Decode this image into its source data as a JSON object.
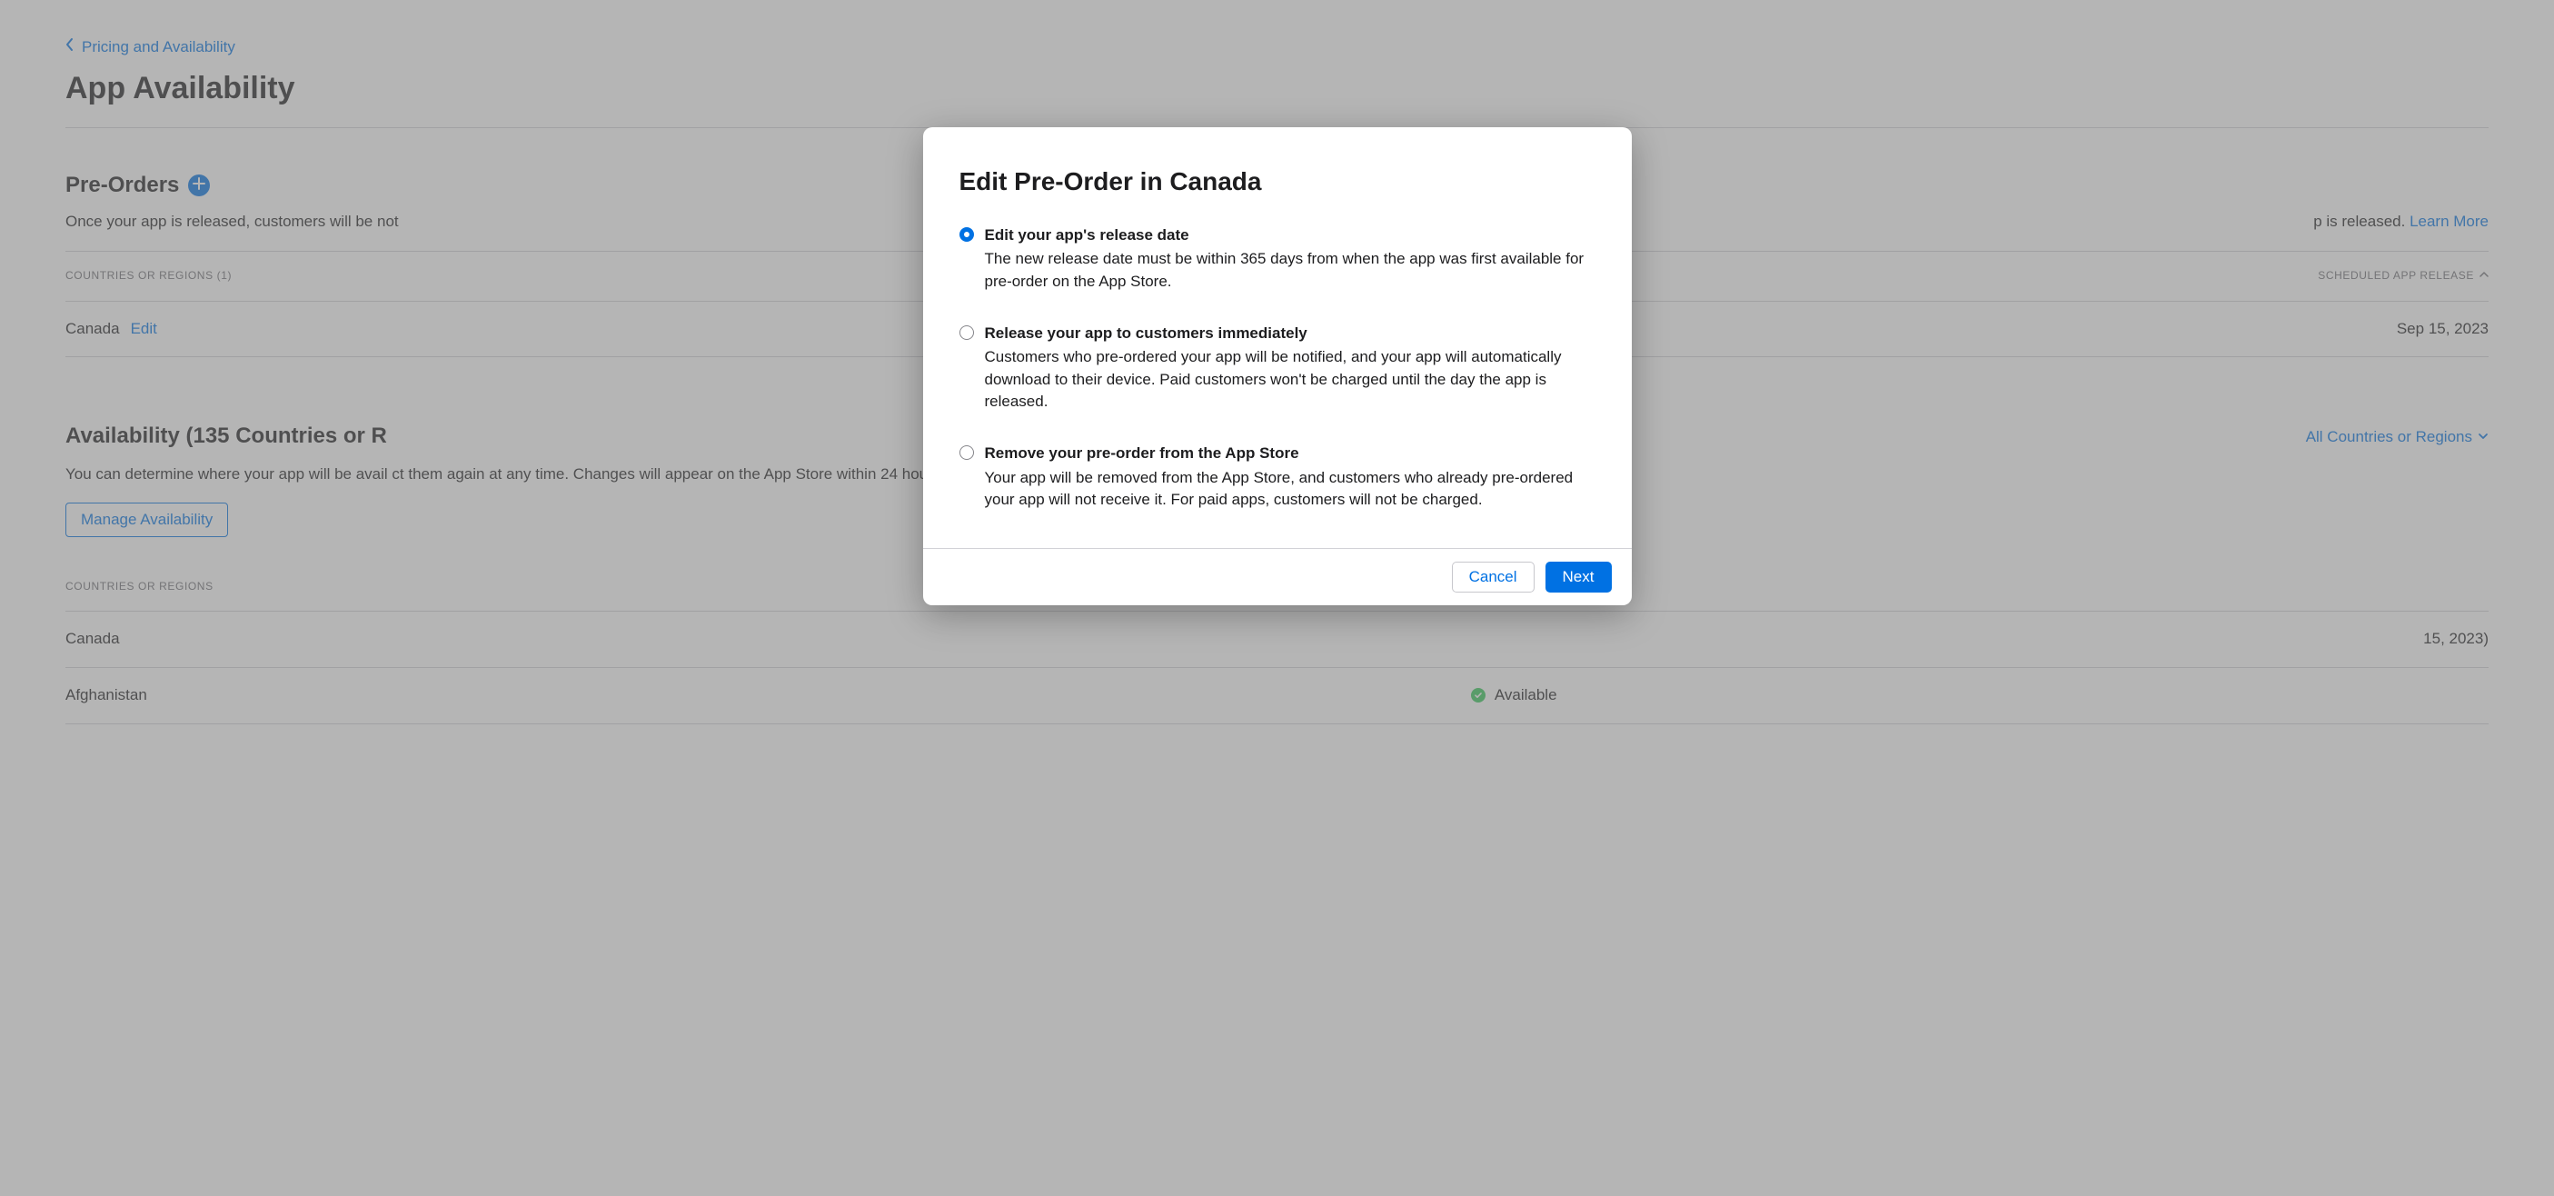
{
  "breadcrumb": {
    "label": "Pricing and Availability"
  },
  "page_title": "App Availability",
  "preorders": {
    "heading": "Pre-Orders",
    "description_prefix": "Once your app is released, customers will be not",
    "description_suffix": "p is released. ",
    "learn_more": "Learn More",
    "col_left": "COUNTRIES OR REGIONS (1)",
    "col_right": "SCHEDULED APP RELEASE",
    "row": {
      "country": "Canada",
      "edit": "Edit",
      "date": "Sep 15, 2023"
    }
  },
  "availability": {
    "heading": "Availability (135 Countries or R",
    "dropdown": "All Countries or Regions",
    "description": "You can determine where your app will be avail                                                                                                                                                                                  ct them again at any time. Changes will appear on the App Store within 24 hours.",
    "manage_button": "Manage Availability",
    "col_left": "COUNTRIES OR REGIONS",
    "rows": [
      {
        "country": "Canada",
        "status_suffix": "15, 2023)"
      },
      {
        "country": "Afghanistan",
        "status": "Available"
      }
    ]
  },
  "modal": {
    "title": "Edit Pre-Order in Canada",
    "options": [
      {
        "title": "Edit your app's release date",
        "desc": "The new release date must be within 365 days from when the app was first available for pre-order on the App Store.",
        "selected": true
      },
      {
        "title": "Release your app to customers immediately",
        "desc": "Customers who pre-ordered your app will be notified, and your app will automatically download to their device. Paid customers won't be charged until the day the app is released.",
        "selected": false
      },
      {
        "title": "Remove your pre-order from the App Store",
        "desc": "Your app will be removed from the App Store, and customers who already pre-ordered your app will not receive it. For paid apps, customers will not be charged.",
        "selected": false
      }
    ],
    "cancel": "Cancel",
    "next": "Next"
  }
}
